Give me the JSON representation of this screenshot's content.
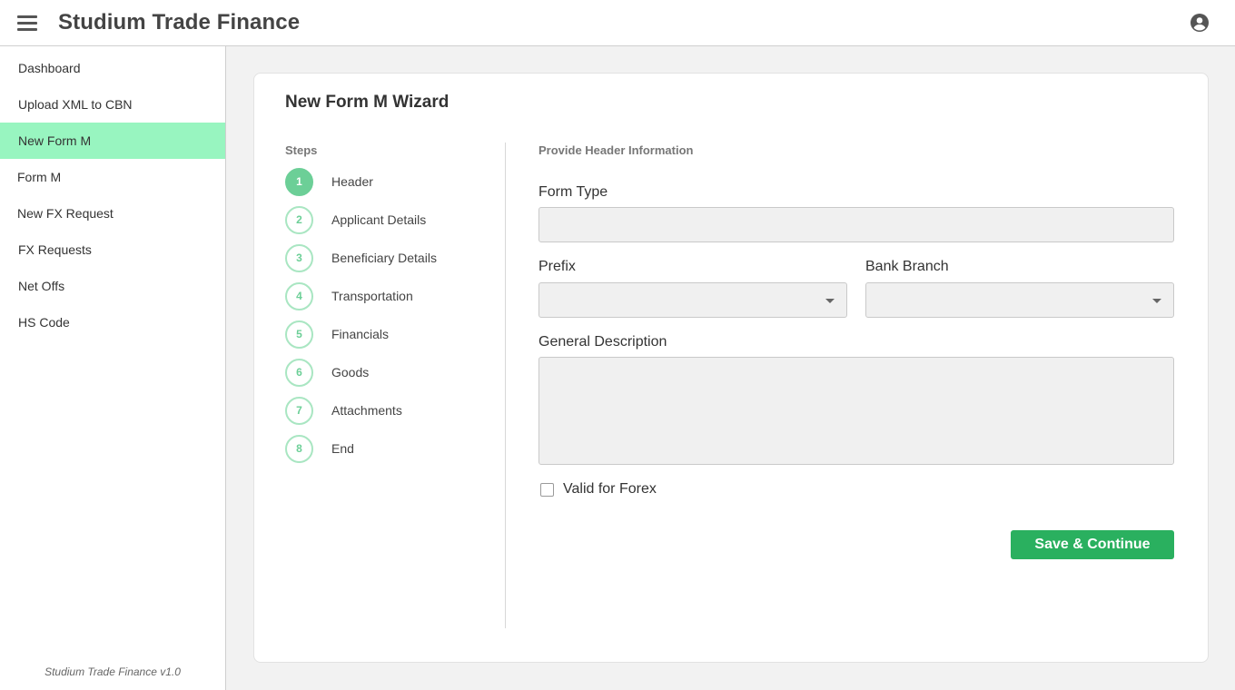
{
  "header": {
    "title": "Studium Trade Finance",
    "menu_icon": "hamburger-menu-icon",
    "account_icon": "account-circle-icon"
  },
  "sidebar": {
    "items": [
      {
        "label": "Dashboard",
        "active": false
      },
      {
        "label": "Upload XML to CBN",
        "active": false
      },
      {
        "label": "New Form M",
        "active": true
      },
      {
        "label": "Form M",
        "active": false
      },
      {
        "label": "New FX Request",
        "active": false
      },
      {
        "label": "FX Requests",
        "active": false
      },
      {
        "label": "Net Offs",
        "active": false
      },
      {
        "label": "HS Code",
        "active": false
      }
    ],
    "version": "Studium Trade Finance v1.0",
    "active_color": "#98f5c0"
  },
  "wizard": {
    "title": "New Form M Wizard",
    "steps_heading": "Steps",
    "steps": [
      {
        "number": "1",
        "label": "Header",
        "active": true
      },
      {
        "number": "2",
        "label": "Applicant Details",
        "active": false
      },
      {
        "number": "3",
        "label": "Beneficiary Details",
        "active": false
      },
      {
        "number": "4",
        "label": "Transportation",
        "active": false
      },
      {
        "number": "5",
        "label": "Financials",
        "active": false
      },
      {
        "number": "6",
        "label": "Goods",
        "active": false
      },
      {
        "number": "7",
        "label": "Attachments",
        "active": false
      },
      {
        "number": "8",
        "label": "End",
        "active": false
      }
    ],
    "accent_color": "#6ccf97"
  },
  "form": {
    "section_heading": "Provide Header Information",
    "form_type": {
      "label": "Form Type",
      "value": ""
    },
    "prefix": {
      "label": "Prefix",
      "value": ""
    },
    "bank_branch": {
      "label": "Bank Branch",
      "value": ""
    },
    "general_description": {
      "label": "General Description",
      "value": ""
    },
    "valid_for_forex": {
      "label": "Valid for Forex",
      "checked": false
    },
    "save_label": "Save & Continue",
    "button_color": "#2ab05f"
  }
}
